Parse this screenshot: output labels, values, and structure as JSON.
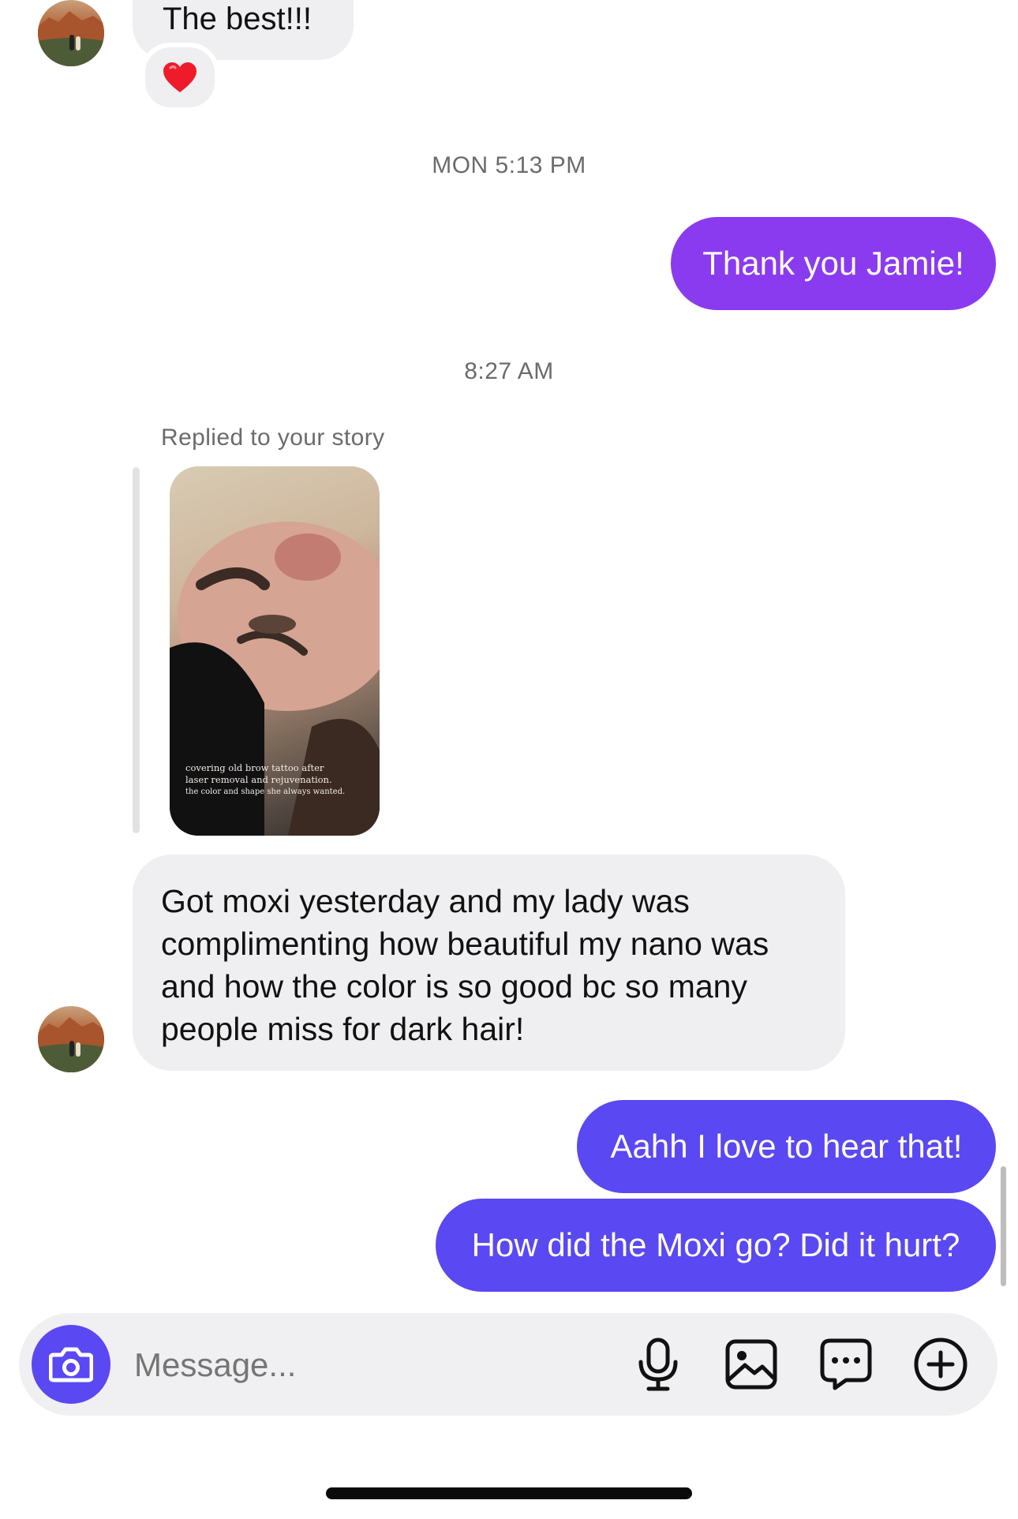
{
  "messages": {
    "first": {
      "text": "The best!!!",
      "reaction": "heart-emoji"
    },
    "ts1": "MON 5:13 PM",
    "thank": "Thank you Jamie!",
    "ts2": "8:27 AM",
    "story": {
      "replied_label": "Replied to your story",
      "caption_1": "covering old brow tattoo after",
      "caption_2": "laser removal and rejuvenation.",
      "caption_3": "the color and shape she always wanted."
    },
    "long": {
      "line1": "Got moxi yesterday and my lady was",
      "line2": "complimenting how beautiful my nano was",
      "line3": "and how the color is so good bc so many",
      "line4": "people miss for dark hair!"
    },
    "aahh": "Aahh I love to hear that!",
    "moxi": "How did the Moxi go? Did it hurt?"
  },
  "composer": {
    "placeholder": "Message...",
    "icons": [
      "camera-icon",
      "microphone-icon",
      "gallery-icon",
      "sticker-icon",
      "plus-icon"
    ]
  },
  "colors": {
    "outgoing_purple": "#8a3bf0",
    "outgoing_indigo": "#5a48f2",
    "incoming_bg": "#efeff1",
    "camera_button": "#5a48f2"
  }
}
